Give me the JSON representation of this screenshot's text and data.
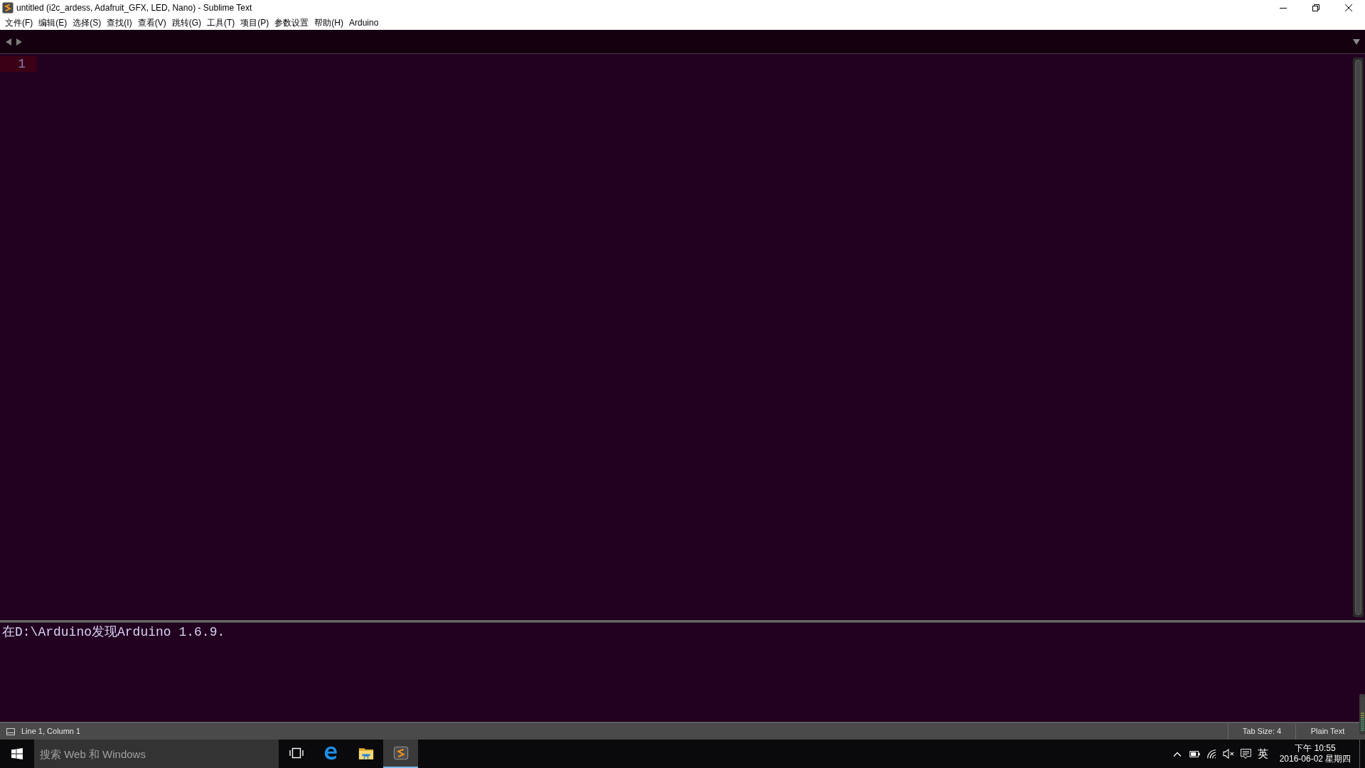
{
  "window": {
    "title": "untitled (i2c_ardess, Adafruit_GFX, LED, Nano) - Sublime Text"
  },
  "menu": [
    "文件(F)",
    "编辑(E)",
    "选择(S)",
    "查找(I)",
    "查看(V)",
    "跳转(G)",
    "工具(T)",
    "项目(P)",
    "参数设置",
    "帮助(H)",
    "Arduino"
  ],
  "editor": {
    "lines": [
      {
        "number": "1",
        "current": true
      }
    ]
  },
  "output_panel": {
    "lines": [
      "在D:\\Arduino发现Arduino 1.6.9."
    ]
  },
  "status_bar": {
    "position": "Line 1, Column 1",
    "tab_size": "Tab Size: 4",
    "syntax": "Plain Text"
  },
  "taskbar": {
    "search": {
      "placeholder": "搜索 Web 和 Windows"
    },
    "apps": [
      {
        "kind": "task-view",
        "selected": false
      },
      {
        "kind": "edge",
        "selected": false
      },
      {
        "kind": "explorer",
        "selected": false
      },
      {
        "kind": "sublime",
        "selected": true
      }
    ],
    "tray": {
      "input_method": "英",
      "time": "下午 10:55",
      "date": "2016-06-02 星期四"
    }
  }
}
